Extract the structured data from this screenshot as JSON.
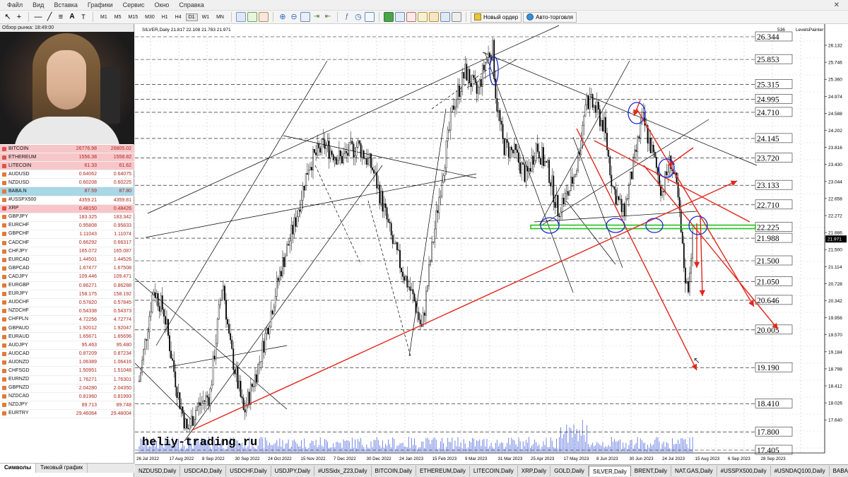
{
  "menu": [
    "Файл",
    "Вид",
    "Вставка",
    "Графики",
    "Сервис",
    "Окно",
    "Справка"
  ],
  "toolbar": {
    "timeframes": [
      "M1",
      "M5",
      "M15",
      "M30",
      "H1",
      "H4",
      "D1",
      "W1",
      "MN"
    ],
    "active_timeframe": "D1",
    "new_order_label": "Новый ордер",
    "auto_trading_label": "Авто-торговля"
  },
  "market_watch": {
    "title": "Обзор рынка: 18:49:00",
    "quotes": [
      {
        "symbol": "BITCOIN",
        "bid": "26776.98",
        "ask": "26805.02",
        "highlight": "red"
      },
      {
        "symbol": "ETHEREUM",
        "bid": "1556.38",
        "ask": "1558.82",
        "highlight": "red"
      },
      {
        "symbol": "LITECOIN",
        "bid": "61.33",
        "ask": "61.62",
        "highlight": "red"
      },
      {
        "symbol": "AUDUSD",
        "bid": "0.64062",
        "ask": "0.64075",
        "highlight": ""
      },
      {
        "symbol": "NZDUSD",
        "bid": "0.60208",
        "ask": "0.60225",
        "highlight": ""
      },
      {
        "symbol": "BABA.N",
        "bid": "87.59",
        "ask": "87.80",
        "highlight": "blue"
      },
      {
        "symbol": "#USSPX500",
        "bid": "4359.21",
        "ask": "4359.81",
        "highlight": ""
      },
      {
        "symbol": "XRP",
        "bid": "0.48150",
        "ask": "0.48426",
        "highlight": "red"
      },
      {
        "symbol": "GBPJPY",
        "bid": "183.325",
        "ask": "183.342",
        "highlight": ""
      },
      {
        "symbol": "EURCHF",
        "bid": "0.95808",
        "ask": "0.95833",
        "highlight": ""
      },
      {
        "symbol": "GBPCHF",
        "bid": "1.11043",
        "ask": "1.11074",
        "highlight": ""
      },
      {
        "symbol": "CADCHF",
        "bid": "0.66292",
        "ask": "0.66317",
        "highlight": ""
      },
      {
        "symbol": "CHFJPY",
        "bid": "165.072",
        "ask": "165.087",
        "highlight": ""
      },
      {
        "symbol": "EURCAD",
        "bid": "1.44501",
        "ask": "1.44526",
        "highlight": ""
      },
      {
        "symbol": "GBPCAD",
        "bid": "1.67477",
        "ask": "1.67508",
        "highlight": ""
      },
      {
        "symbol": "CADJPY",
        "bid": "109.446",
        "ask": "109.471",
        "highlight": ""
      },
      {
        "symbol": "EURGBP",
        "bid": "0.86271",
        "ask": "0.86288",
        "highlight": ""
      },
      {
        "symbol": "EURJPY",
        "bid": "158.175",
        "ask": "158.192",
        "highlight": ""
      },
      {
        "symbol": "AUDCHF",
        "bid": "0.57820",
        "ask": "0.57845",
        "highlight": ""
      },
      {
        "symbol": "NZDCHF",
        "bid": "0.54338",
        "ask": "0.54373",
        "highlight": ""
      },
      {
        "symbol": "CHFPLN",
        "bid": "4.72256",
        "ask": "4.72774",
        "highlight": ""
      },
      {
        "symbol": "GBPAUD",
        "bid": "1.92012",
        "ask": "1.92047",
        "highlight": ""
      },
      {
        "symbol": "EURAUD",
        "bid": "1.65671",
        "ask": "1.65696",
        "highlight": ""
      },
      {
        "symbol": "AUDJPY",
        "bid": "95.463",
        "ask": "95.480",
        "highlight": ""
      },
      {
        "symbol": "AUDCAD",
        "bid": "0.87209",
        "ask": "0.87234",
        "highlight": ""
      },
      {
        "symbol": "AUDNZD",
        "bid": "1.06389",
        "ask": "1.06416",
        "highlight": ""
      },
      {
        "symbol": "CHFSGD",
        "bid": "1.50951",
        "ask": "1.51048",
        "highlight": ""
      },
      {
        "symbol": "EURNZD",
        "bid": "1.76271",
        "ask": "1.76301",
        "highlight": ""
      },
      {
        "symbol": "GBPNZD",
        "bid": "2.04280",
        "ask": "2.04350",
        "highlight": ""
      },
      {
        "symbol": "NZDCAD",
        "bid": "0.81960",
        "ask": "0.81993",
        "highlight": ""
      },
      {
        "symbol": "NZDJPY",
        "bid": "89.713",
        "ask": "89.748",
        "highlight": ""
      },
      {
        "symbol": "EURTRY",
        "bid": "29.46064",
        "ask": "29.48004",
        "highlight": ""
      }
    ],
    "tabs": [
      "Символы",
      "Тиковый график"
    ]
  },
  "chart": {
    "info": "SILVER,Daily  21.817 22.108 21.783 21.971",
    "indicator_label": "LevelsPainter",
    "watermark": "heliy-trading.ru",
    "corner_number": "536",
    "current_price": "21.971",
    "axis_prices": [
      "26.132",
      "25.746",
      "25.360",
      "24.974",
      "24.588",
      "24.202",
      "23.816",
      "23.430",
      "23.044",
      "22.658",
      "22.272",
      "21.886",
      "21.500",
      "21.114",
      "20.728",
      "20.342",
      "19.956",
      "19.570",
      "19.184",
      "18.798",
      "18.412",
      "18.026",
      "17.640"
    ],
    "level_labels": [
      "26.344",
      "25.853",
      "25.315",
      "24.995",
      "24.710",
      "24.145",
      "23.720",
      "23.133",
      "22.710",
      "22.225",
      "21.988",
      "21.500",
      "21.050",
      "20.646",
      "20.005",
      "19.190",
      "18.410",
      "17.800",
      "17.405"
    ],
    "date_labels": [
      "26 Jul 2022",
      "17 Aug 2022",
      "8 Sep 2022",
      "30 Sep 2022",
      "24 Oct 2022",
      "15 Nov 2022",
      "7 Dec 2022",
      "30 Dec 2022",
      "24 Jan 2023",
      "15 Feb 2023",
      "9 Mar 2023",
      "31 Mar 2023",
      "25 Apr 2023",
      "17 May 2023",
      "8 Jun 2023",
      "30 Jun 2023",
      "24 Jul 2023",
      "15 Aug 2023",
      "6 Sep 2023",
      "28 Sep 2023"
    ]
  },
  "chart_tabs": [
    "NZDUSD,Daily",
    "USDCAD,Daily",
    "USDCHF,Daily",
    "USDJPY,Daily",
    "#USSidx_Z23,Daily",
    "BITCOIN,Daily",
    "ETHEREUM,Daily",
    "LITECOIN,Daily",
    "XRP,Daily",
    "GOLD,Daily",
    "SILVER,Daily",
    "BRENT,Daily",
    "NAT.GAS,Daily",
    "#USSPX500,Daily",
    "#USNDAQ100,Daily",
    "BABA.N,Daily"
  ],
  "active_chart_tab": "SILVER,Daily",
  "colors": {
    "bg": "#ffffff",
    "candle": "#000000",
    "trendline": "#000000",
    "red_annotation": "#e0271c",
    "blue_circle": "#1a2ad6",
    "green_level": "#22c21a",
    "volume": "#2f4fd8"
  }
}
